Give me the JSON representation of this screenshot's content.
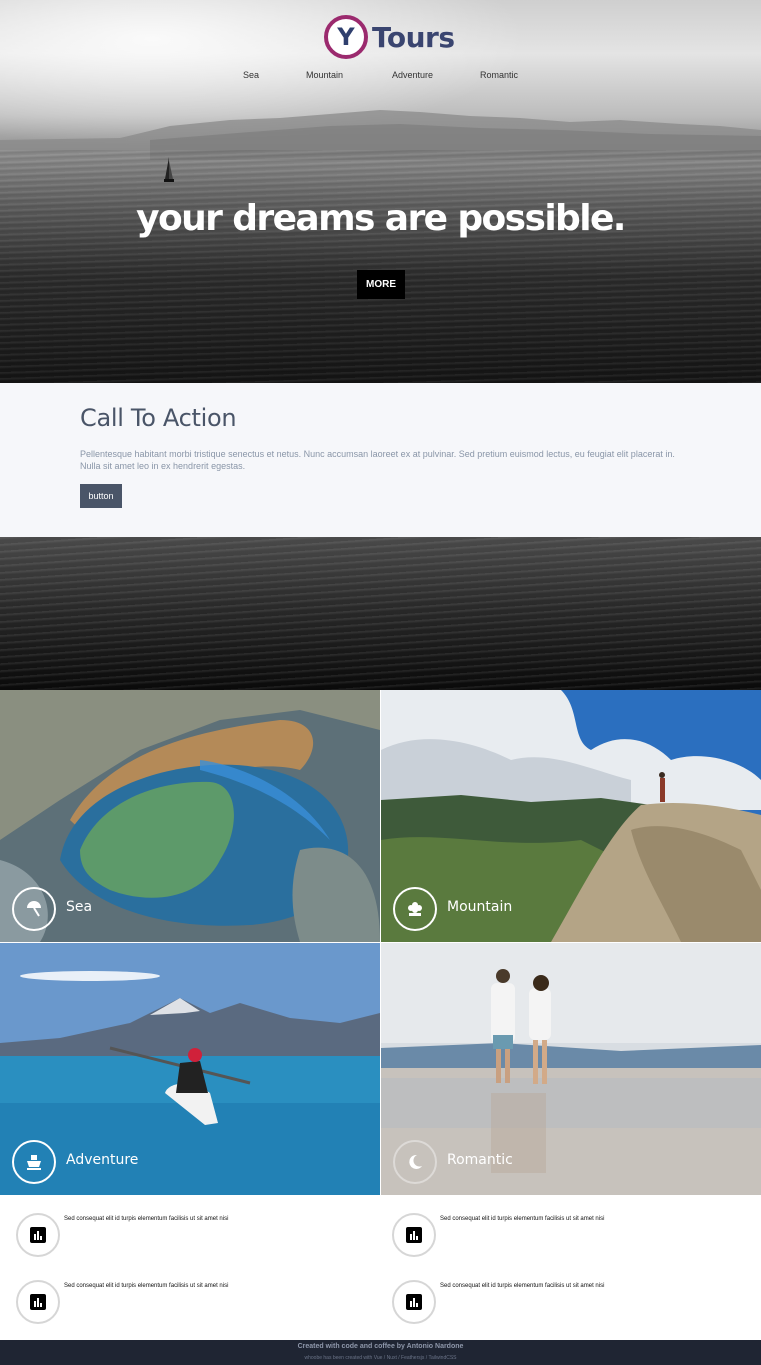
{
  "brand": {
    "logo_letter": "Y",
    "name": "Tours",
    "accent": "#9b2a6e",
    "logo_text_color": "#3a4570"
  },
  "nav": {
    "items": [
      {
        "label": "Sea"
      },
      {
        "label": "Mountain"
      },
      {
        "label": "Adventure"
      },
      {
        "label": "Romantic"
      }
    ]
  },
  "hero": {
    "headline": "your dreams are possible.",
    "button_label": "MORE"
  },
  "cta": {
    "title": "Call To Action",
    "text": "Pellentesque habitant morbi tristique senectus et netus. Nunc accumsan laoreet ex at pulvinar. Sed pretium euismod lectus, eu feugiat elit placerat in. Nulla sit amet leo in ex hendrerit egestas.",
    "button_label": "button",
    "button_color": "#4a5568"
  },
  "tiles": [
    {
      "label": "Sea",
      "icon": "umbrella-icon"
    },
    {
      "label": "Mountain",
      "icon": "flower-icon"
    },
    {
      "label": "Adventure",
      "icon": "ship-icon"
    },
    {
      "label": "Romantic",
      "icon": "moon-icon"
    }
  ],
  "features": [
    {
      "text": "Sed consequat elit id turpis elementum facilisis ut sit amet nisi",
      "icon": "bar-chart-icon"
    },
    {
      "text": "Sed consequat elit id turpis elementum facilisis ut sit amet nisi",
      "icon": "bar-chart-icon"
    },
    {
      "text": "Sed consequat elit id turpis elementum facilisis ut sit amet nisi",
      "icon": "bar-chart-icon"
    },
    {
      "text": "Sed consequat elit id turpis elementum facilisis ut sit amet nisi",
      "icon": "bar-chart-icon"
    }
  ],
  "footer": {
    "line1": "Created with code and coffee by Antonio Nardone",
    "line2": "whoobe has been created with Vue / Nuxt / Feathersjs / TailwindCSS"
  }
}
